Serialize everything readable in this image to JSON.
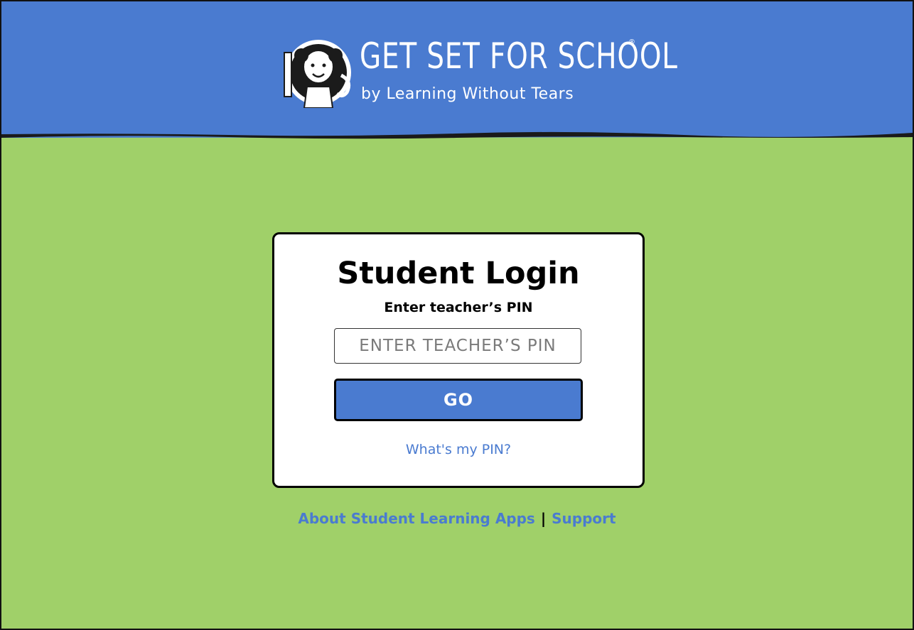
{
  "header": {
    "brand_title": "GET SET FOR SCHOOL",
    "brand_registered": "®",
    "brand_subtitle": "by Learning Without Tears",
    "background_color": "#4a7bd0"
  },
  "login": {
    "title": "Student Login",
    "subtitle": "Enter teacher’s PIN",
    "pin_placeholder": "ENTER TEACHER’S PIN",
    "pin_value": "",
    "go_label": "GO",
    "help_link": "What's my PIN?"
  },
  "footer": {
    "about_link": "About Student Learning Apps",
    "separator": "|",
    "support_link": "Support"
  },
  "colors": {
    "page_background": "#a0d069",
    "accent": "#4a7bd0"
  }
}
